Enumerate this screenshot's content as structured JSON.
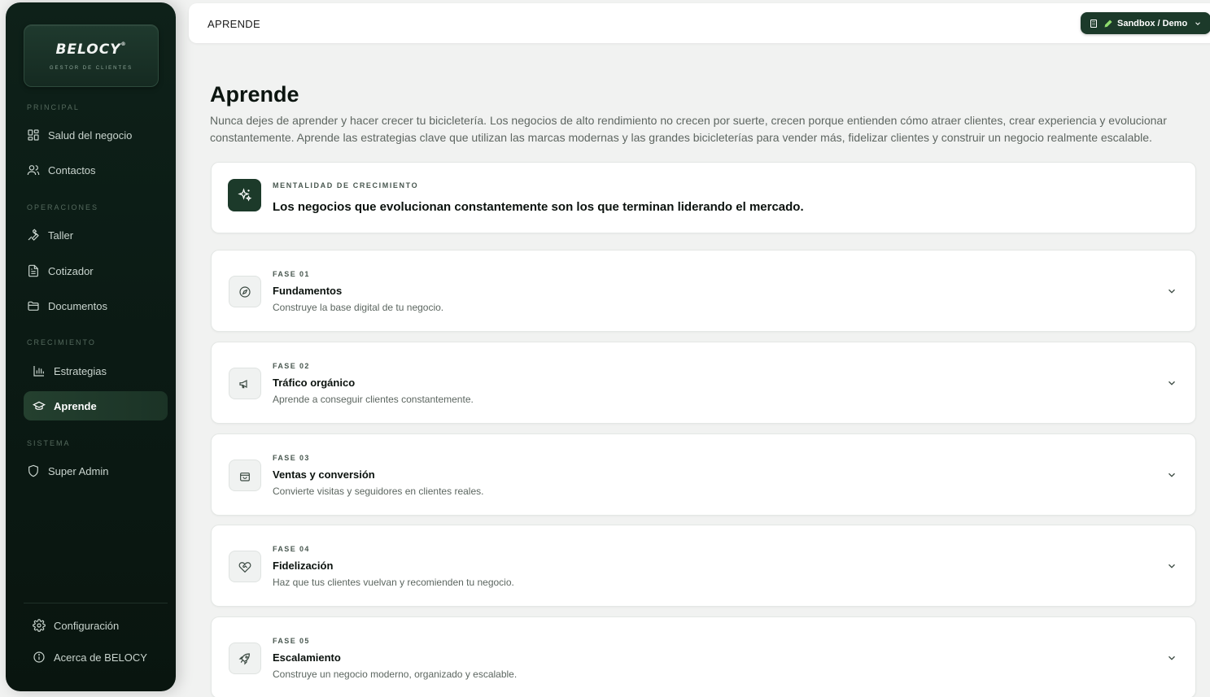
{
  "brand": {
    "name": "BELOCY",
    "registered": "®",
    "tagline": "GESTOR DE CLIENTES"
  },
  "sidebar": {
    "sections": [
      {
        "label": "PRINCIPAL"
      },
      {
        "label": "OPERACIONES"
      },
      {
        "label": "CRECIMIENTO"
      },
      {
        "label": "SISTEMA"
      }
    ],
    "items": [
      {
        "label": "Salud del negocio",
        "icon": "dashboard-grid-icon"
      },
      {
        "label": "Contactos",
        "icon": "users-icon"
      },
      {
        "label": "Taller",
        "icon": "wrench-icon"
      },
      {
        "label": "Cotizador",
        "icon": "document-icon"
      },
      {
        "label": "Documentos",
        "icon": "folder-icon"
      },
      {
        "label": "Estrategias",
        "icon": "bar-chart-icon"
      },
      {
        "label": "Aprende",
        "icon": "graduation-cap-icon",
        "active": true
      },
      {
        "label": "Super Admin",
        "icon": "shield-icon"
      }
    ],
    "footer": [
      {
        "label": "Configuración",
        "icon": "gear-icon"
      },
      {
        "label": "Acerca de BELOCY",
        "icon": "info-icon"
      }
    ]
  },
  "topbar": {
    "breadcrumb": "APRENDE",
    "environment": "Sandbox / Demo"
  },
  "main": {
    "title": "Aprende",
    "description": "Nunca dejes de aprender y hacer crecer tu bicicletería. Los negocios de alto rendimiento no crecen por suerte, crecen porque entienden cómo atraer clientes, crear experiencia y evolucionar constantemente. Aprende las estrategias clave que utilizan las marcas modernas y las grandes bicicleterías para vender más, fidelizar clientes y construir un negocio realmente escalable.",
    "hero": {
      "kicker": "MENTALIDAD DE CRECIMIENTO",
      "headline": "Los negocios que evolucionan constantemente son los que terminan liderando el mercado."
    },
    "phases": [
      {
        "kicker": "FASE 01",
        "title": "Fundamentos",
        "subtitle": "Construye la base digital de tu negocio.",
        "icon": "compass-icon"
      },
      {
        "kicker": "FASE 02",
        "title": "Tráfico orgánico",
        "subtitle": "Aprende a conseguir clientes constantemente.",
        "icon": "megaphone-icon"
      },
      {
        "kicker": "FASE 03",
        "title": "Ventas y conversión",
        "subtitle": "Convierte visitas y seguidores en clientes reales.",
        "icon": "shopping-bag-icon"
      },
      {
        "kicker": "FASE 04",
        "title": "Fidelización",
        "subtitle": "Haz que tus clientes vuelvan y recomienden tu negocio.",
        "icon": "heart-handshake-icon"
      },
      {
        "kicker": "FASE 05",
        "title": "Escalamiento",
        "subtitle": "Construye un negocio moderno, organizado y escalable.",
        "icon": "rocket-icon"
      }
    ]
  },
  "colors": {
    "sidebar_bg": "#0b1a14",
    "accent": "#1c3a2a",
    "active_item": "#24402f",
    "page_bg": "#f1f2f1"
  }
}
